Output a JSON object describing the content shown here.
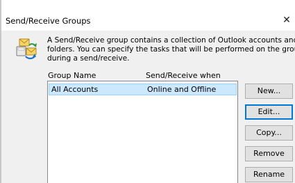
{
  "window": {
    "title": "Send/Receive Groups",
    "close_glyph": "✕"
  },
  "description": {
    "line1": "A Send/Receive group contains a collection of Outlook accounts and",
    "line2": "folders. You can specify the tasks that will be performed on the group",
    "line3": "during a send/receive."
  },
  "list": {
    "columns": [
      "Group Name",
      "Send/Receive when"
    ],
    "rows": [
      {
        "name": "All Accounts",
        "when": "Online and Offline",
        "selected": true
      }
    ]
  },
  "buttons": {
    "new": "New...",
    "edit": "Edit...",
    "copy": "Copy...",
    "remove": "Remove",
    "rename": "Rename"
  },
  "colors": {
    "selection_fill": "#cce8ff",
    "selection_border": "#99d1ff",
    "default_button_border": "#0078d7",
    "dialog_body": "#f0f0f0"
  },
  "icons": {
    "group": "send-receive-groups-icon",
    "close": "close-icon"
  }
}
